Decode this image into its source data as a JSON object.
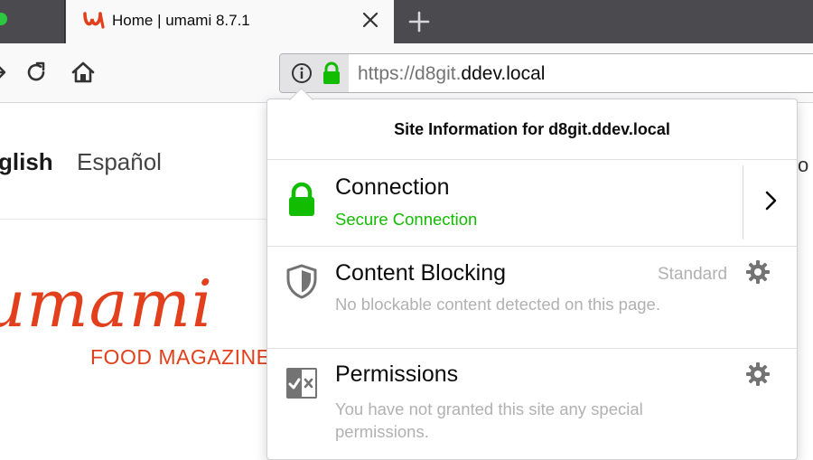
{
  "browser": {
    "tab": {
      "title": "Home | umami 8.7.1",
      "favicon": "umami-favicon-icon"
    },
    "url": {
      "host_prefix": "https://d8git.",
      "host_main": "ddev.local"
    }
  },
  "page": {
    "languages": [
      "glish",
      "Español"
    ],
    "right_fragment": "vo",
    "logo_text": "umami",
    "logo_subtitle": "FOOD MAGAZINE"
  },
  "site_info": {
    "header": "Site Information for d8git.ddev.local",
    "connection": {
      "title": "Connection",
      "status": "Secure Connection",
      "status_color": "#12bc00",
      "icon": "lock-icon"
    },
    "content_blocking": {
      "title": "Content Blocking",
      "mode": "Standard",
      "description": "No blockable content detected on this page.",
      "icon": "shield-icon"
    },
    "permissions": {
      "title": "Permissions",
      "description": "You have not granted this site any special permissions.",
      "icon": "permissions-icon"
    }
  },
  "colors": {
    "brand": "#e2401c",
    "secure_green": "#12bc00",
    "tabstrip": "#4a4a4f"
  }
}
